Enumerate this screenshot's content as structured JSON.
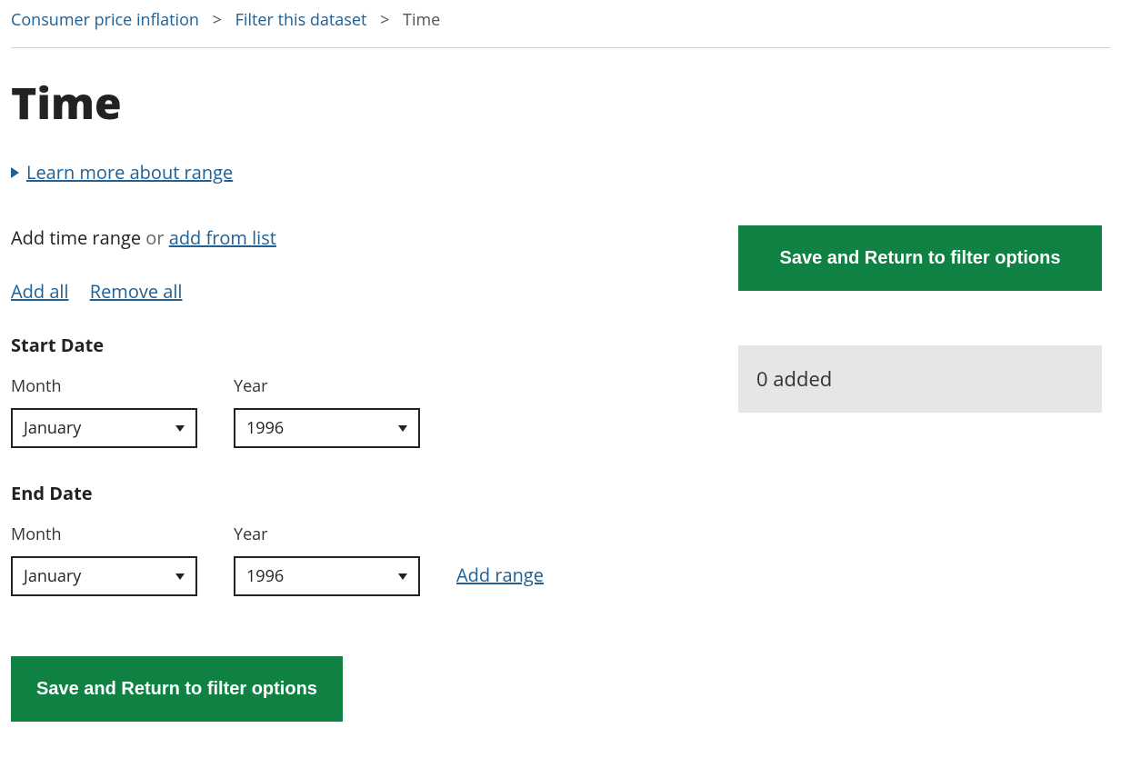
{
  "breadcrumb": {
    "item1": "Consumer price inflation",
    "item2": "Filter this dataset",
    "current": "Time"
  },
  "page_title": "Time",
  "learn_more": "Learn more about range",
  "add_section": {
    "prefix": "Add time range",
    "or": "or",
    "add_from_list": "add from list"
  },
  "bulk": {
    "add_all": "Add all",
    "remove_all": "Remove all"
  },
  "start": {
    "label": "Start Date",
    "month_label": "Month",
    "year_label": "Year",
    "month_value": "January",
    "year_value": "1996"
  },
  "end": {
    "label": "End Date",
    "month_label": "Month",
    "year_label": "Year",
    "month_value": "January",
    "year_value": "1996"
  },
  "add_range": "Add range",
  "save_button": "Save and Return to filter options",
  "added_status": "0 added"
}
